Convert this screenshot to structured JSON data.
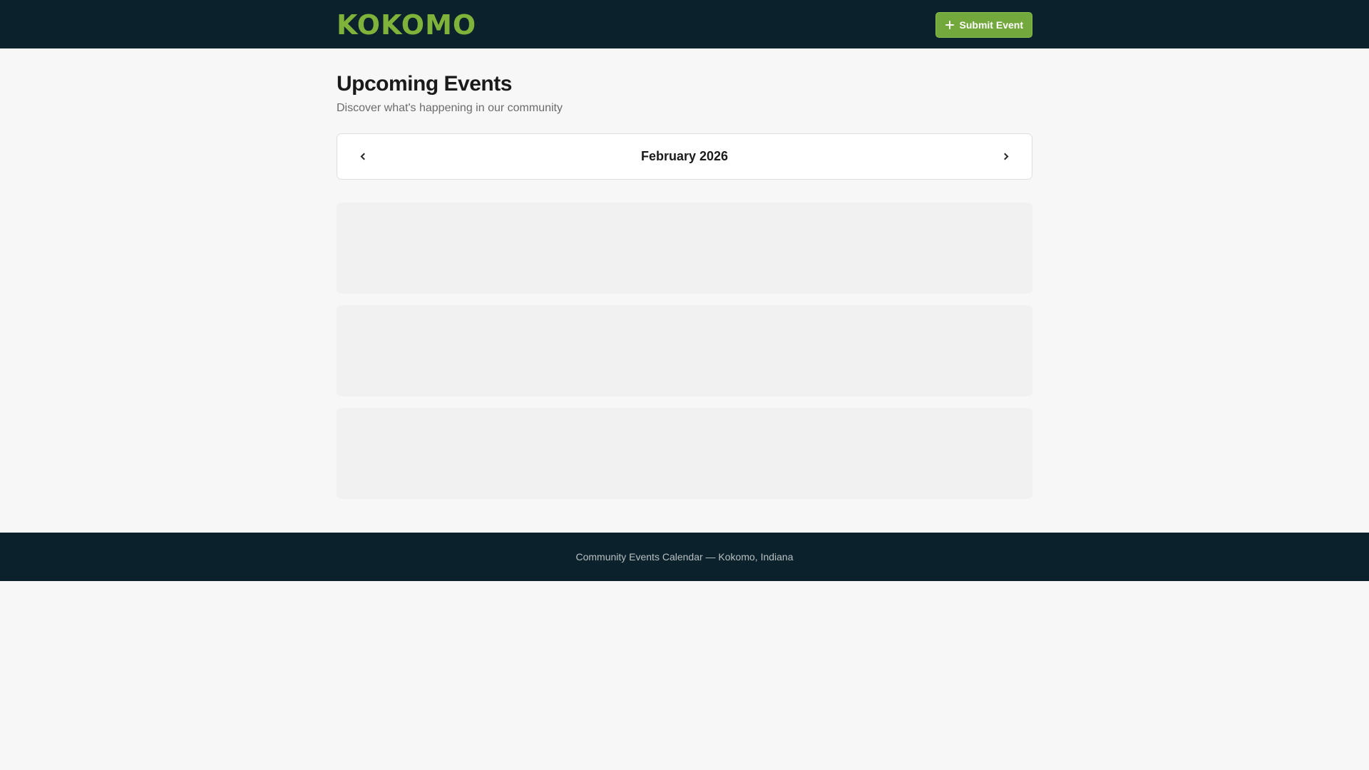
{
  "header": {
    "logo_text": "KOKOMO",
    "submit_label": "Submit Event"
  },
  "main": {
    "title": "Upcoming Events",
    "subtitle": "Discover what's happening in our community",
    "month_nav": {
      "month_label": "February 2026"
    }
  },
  "footer": {
    "text": "Community Events Calendar — Kokomo, Indiana"
  },
  "colors": {
    "header_bg": "#0b212b",
    "brand_green": "#7fb23a",
    "button_green": "#73a83c",
    "page_bg": "#f7f7f7"
  }
}
